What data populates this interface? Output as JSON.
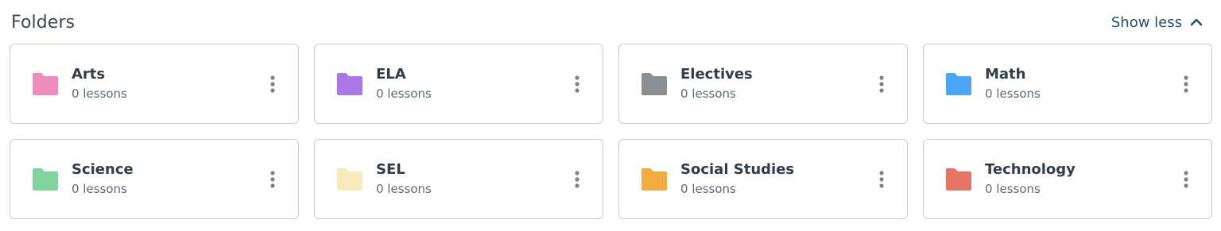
{
  "section": {
    "title": "Folders",
    "toggle_label": "Show less",
    "toggle_icon": "chevron-up-icon"
  },
  "folders": [
    {
      "name": "Arts",
      "count_text": "0 lessons",
      "color": "#f08bbd"
    },
    {
      "name": "ELA",
      "count_text": "0 lessons",
      "color": "#a977e8"
    },
    {
      "name": "Electives",
      "count_text": "0 lessons",
      "color": "#8a8f94"
    },
    {
      "name": "Math",
      "count_text": "0 lessons",
      "color": "#4aa5f5"
    },
    {
      "name": "Science",
      "count_text": "0 lessons",
      "color": "#7fd39b"
    },
    {
      "name": "SEL",
      "count_text": "0 lessons",
      "color": "#f8e9b8"
    },
    {
      "name": "Social Studies",
      "count_text": "0 lessons",
      "color": "#f2ab3c"
    },
    {
      "name": "Technology",
      "count_text": "0 lessons",
      "color": "#e67565"
    }
  ],
  "icons": {
    "folder": "folder-icon",
    "more": "more-vertical-icon"
  },
  "colors": {
    "title": "#3b4a5a",
    "link": "#1f4e79",
    "card_border": "#c7ccd1",
    "kebab": "#7a828a"
  }
}
